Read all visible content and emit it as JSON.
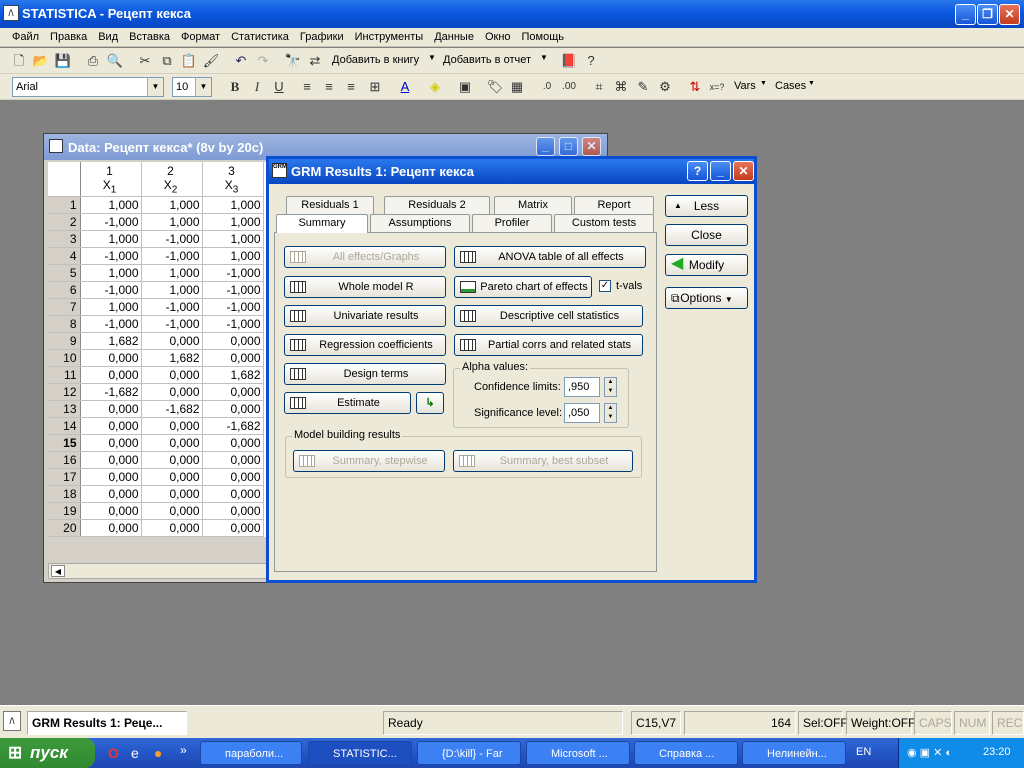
{
  "app": {
    "title": "STATISTICA - Рецепт кекса"
  },
  "menu": [
    "Файл",
    "Правка",
    "Вид",
    "Вставка",
    "Формат",
    "Статистика",
    "Графики",
    "Инструменты",
    "Данные",
    "Окно",
    "Помощь"
  ],
  "toolbar": {
    "add_book": "Добавить в книгу",
    "add_report": "Добавить в отчет",
    "font": "Arial",
    "size": "10",
    "vars": "Vars",
    "cases": "Cases"
  },
  "datawin": {
    "title": "Data: Рецепт кекса* (8v by 20c)",
    "cols": [
      {
        "num": "1",
        "name": "X",
        "sub": "1"
      },
      {
        "num": "2",
        "name": "X",
        "sub": "2"
      },
      {
        "num": "3",
        "name": "X",
        "sub": "3"
      }
    ],
    "rows": [
      [
        "1",
        "1,000",
        "1,000",
        "1,000"
      ],
      [
        "2",
        "-1,000",
        "1,000",
        "1,000"
      ],
      [
        "3",
        "1,000",
        "-1,000",
        "1,000"
      ],
      [
        "4",
        "-1,000",
        "-1,000",
        "1,000"
      ],
      [
        "5",
        "1,000",
        "1,000",
        "-1,000"
      ],
      [
        "6",
        "-1,000",
        "1,000",
        "-1,000"
      ],
      [
        "7",
        "1,000",
        "-1,000",
        "-1,000"
      ],
      [
        "8",
        "-1,000",
        "-1,000",
        "-1,000"
      ],
      [
        "9",
        "1,682",
        "0,000",
        "0,000"
      ],
      [
        "10",
        "0,000",
        "1,682",
        "0,000"
      ],
      [
        "11",
        "0,000",
        "0,000",
        "1,682"
      ],
      [
        "12",
        "-1,682",
        "0,000",
        "0,000"
      ],
      [
        "13",
        "0,000",
        "-1,682",
        "0,000"
      ],
      [
        "14",
        "0,000",
        "0,000",
        "-1,682"
      ],
      [
        "15",
        "0,000",
        "0,000",
        "0,000"
      ],
      [
        "16",
        "0,000",
        "0,000",
        "0,000"
      ],
      [
        "17",
        "0,000",
        "0,000",
        "0,000"
      ],
      [
        "18",
        "0,000",
        "0,000",
        "0,000"
      ],
      [
        "19",
        "0,000",
        "0,000",
        "0,000"
      ],
      [
        "20",
        "0,000",
        "0,000",
        "0,000"
      ]
    ]
  },
  "dialog": {
    "title": "GRM Results 1: Рецепт кекса",
    "tabs_top": [
      "Residuals 1",
      "Residuals 2",
      "Matrix",
      "Report"
    ],
    "tabs_bottom": [
      "Summary",
      "Assumptions",
      "Profiler",
      "Custom tests"
    ],
    "buttons": {
      "all_effects": "All effects/Graphs",
      "anova": "ANOVA table of all effects",
      "whole_model": "Whole model R",
      "pareto": "Pareto chart of effects",
      "univariate": "Univariate results",
      "descriptive": "Descriptive cell statistics",
      "regression": "Regression coefficients",
      "partial": "Partial corrs and related stats",
      "design": "Design terms",
      "estimate": "Estimate",
      "summary_stepwise": "Summary, stepwise",
      "summary_best": "Summary, best subset"
    },
    "tvals": "t-vals",
    "alpha": {
      "label": "Alpha values:",
      "conf_label": "Confidence limits:",
      "conf": ",950",
      "sig_label": "Significance level:",
      "sig": ",050"
    },
    "model_building": "Model building results",
    "side": {
      "less": "Less",
      "close": "Close",
      "modify": "Modify",
      "options": "Options"
    }
  },
  "status": {
    "task": "GRM Results 1: Реце...",
    "ready": "Ready",
    "cell": "C15,V7",
    "num": "164",
    "sel": "Sel:OFF",
    "weight": "Weight:OFF",
    "caps": "CAPS",
    "numlk": "NUM",
    "rec": "REC"
  },
  "taskbar": {
    "start": "пуск",
    "tasks": [
      "параболи...",
      "STATISTIC...",
      "{D:\\kill} - Far",
      "Microsoft ...",
      "Справка ...",
      "Нелинейн..."
    ],
    "lang": "EN",
    "time": "23:20"
  }
}
